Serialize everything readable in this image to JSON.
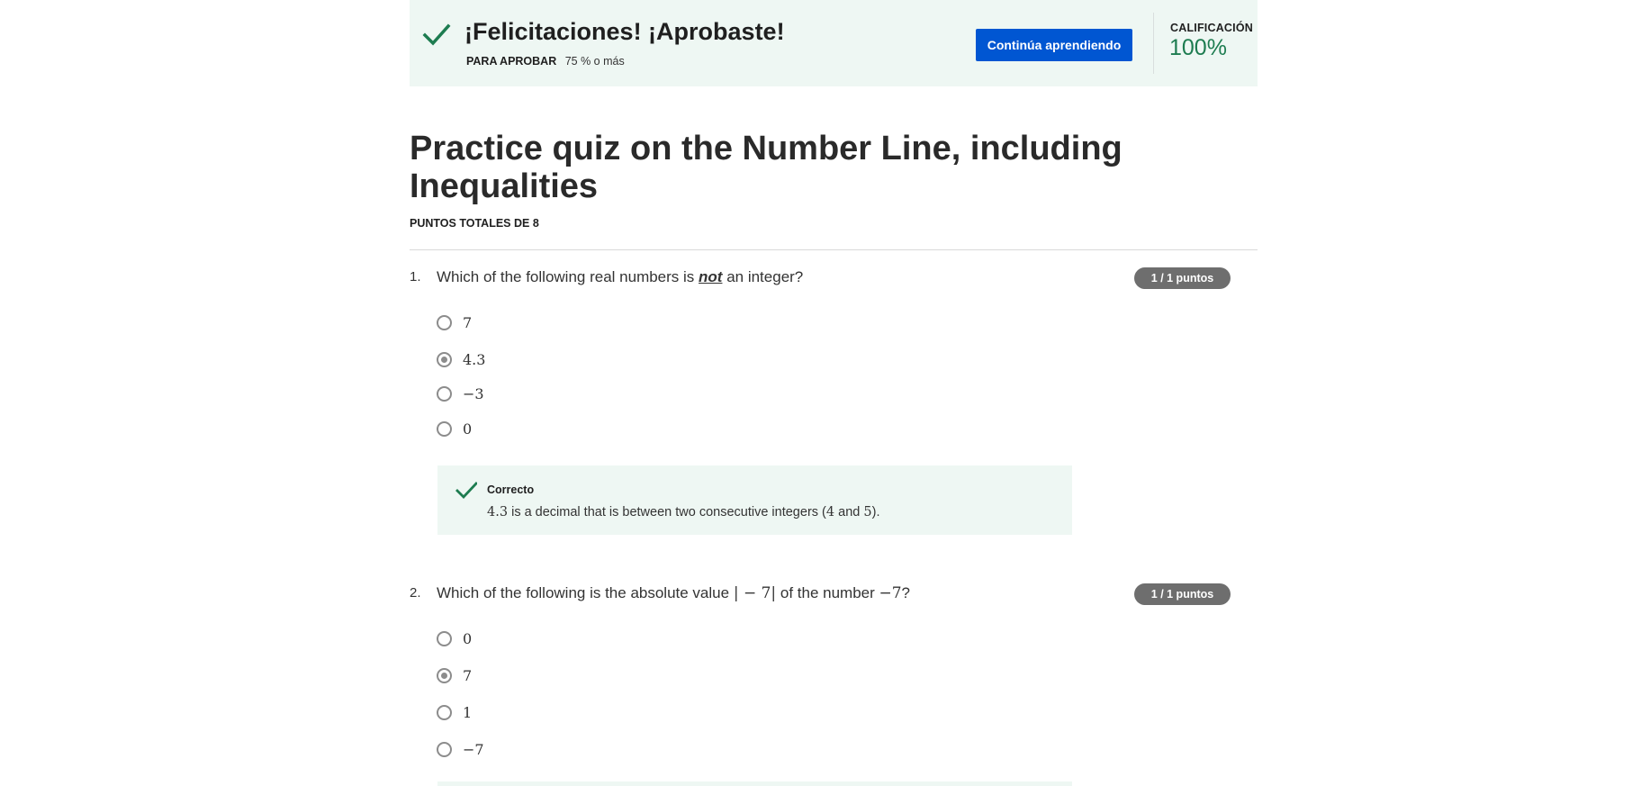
{
  "banner": {
    "title": "¡Felicitaciones! ¡Aprobaste!",
    "pass_label": "PARA APROBAR",
    "pass_value": "75 % o más",
    "cta_label": "Continúa aprendiendo",
    "grade_label": "CALIFICACIÓN",
    "grade_value": "100%"
  },
  "quiz": {
    "title": "Practice quiz on the Number Line, including Inequalities",
    "total_points": "PUNTOS TOTALES DE 8"
  },
  "questions": [
    {
      "number": "1.",
      "text_before": "Which of the following real numbers is ",
      "text_emph": "not",
      "text_after": " an integer?",
      "points": "1 / 1 puntos",
      "options": [
        "7",
        "4.3",
        "−3",
        "0"
      ],
      "selected_index": 1,
      "feedback": {
        "title": "Correcto",
        "math_lead": "4.3",
        "text_mid": " is a decimal that is between two consecutive integers (",
        "math_a": "4",
        "text_and": " and ",
        "math_b": "5",
        "text_end": ")."
      }
    },
    {
      "number": "2.",
      "text_before": "Which of the following is the absolute value ",
      "math_abs": "| − 7|",
      "text_mid": " of the number ",
      "math_num": "−7",
      "text_after": "?",
      "points": "1 / 1 puntos",
      "options": [
        "0",
        "7",
        "1",
        "−7"
      ],
      "selected_index": 1
    }
  ],
  "colors": {
    "banner_bg": "#eef7f3",
    "success_green": "#1d7c50",
    "cta_blue": "#0056d2",
    "badge_gray": "#6e6e6e"
  },
  "icons": {
    "banner": "checkmark-icon",
    "feedback": "checkmark-icon"
  }
}
